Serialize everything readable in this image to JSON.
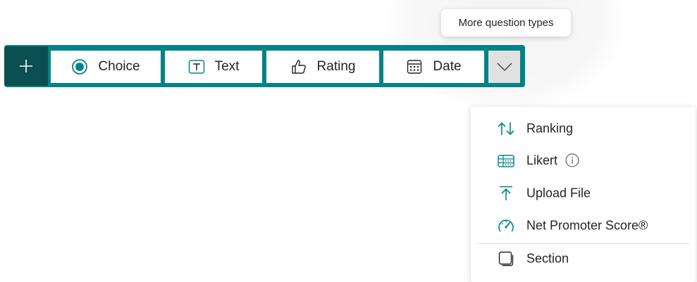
{
  "tooltip": {
    "text": "More question types"
  },
  "toolbar": {
    "add_icon": "plus-icon",
    "buttons": [
      {
        "label": "Choice",
        "icon": "radio-icon"
      },
      {
        "label": "Text",
        "icon": "text-box-icon"
      },
      {
        "label": "Rating",
        "icon": "thumbs-up-icon"
      },
      {
        "label": "Date",
        "icon": "calendar-icon"
      }
    ],
    "more_icon": "chevron-down-icon"
  },
  "menu": {
    "items": [
      {
        "label": "Ranking",
        "icon": "ranking-icon"
      },
      {
        "label": "Likert",
        "icon": "likert-icon",
        "info_icon": "info-icon"
      },
      {
        "label": "Upload File",
        "icon": "upload-icon"
      },
      {
        "label": "Net Promoter Score®",
        "icon": "gauge-icon"
      },
      {
        "label": "Section",
        "icon": "section-icon"
      }
    ]
  },
  "colors": {
    "accent": "#038387",
    "accent_dark": "#0b4f52",
    "more_button_bg": "#e1e1e1",
    "text": "#242424"
  }
}
